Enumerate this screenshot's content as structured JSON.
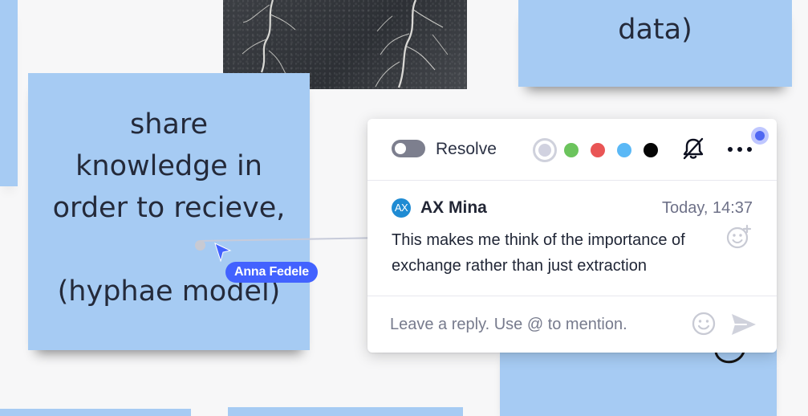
{
  "board": {
    "notes": [
      {
        "text": ""
      },
      {
        "text": "share\nknowledge in\norder to recieve,\n\n(hyphae model)"
      },
      {
        "text": "data)"
      },
      {
        "text": ""
      },
      {
        "text": ""
      },
      {
        "text": ""
      }
    ],
    "note_color": "#a6cbf3",
    "photo_icon": "hyphae-photo-icon"
  },
  "collaborator_cursor": {
    "name": "Anna Fedele",
    "color": "#4262ff"
  },
  "comment_panel": {
    "resolve_label": "Resolve",
    "toggle_state": "off",
    "color_options": [
      {
        "name": "grey",
        "hex": "#d1d2e0",
        "selected": true
      },
      {
        "name": "green",
        "hex": "#6cc45d",
        "selected": false
      },
      {
        "name": "red",
        "hex": "#e95555",
        "selected": false
      },
      {
        "name": "light-blue",
        "hex": "#5ab8f6",
        "selected": false
      },
      {
        "name": "black",
        "hex": "#050505",
        "selected": false
      }
    ],
    "icons": {
      "notifications": "bell-off-icon",
      "more": "more-horizontal-icon",
      "status": "status-dot-icon",
      "reaction": "add-reaction-icon",
      "reply_emoji": "emoji-icon",
      "send": "send-icon"
    },
    "comment": {
      "avatar_initials": "AX",
      "author": "AX Mina",
      "timestamp": "Today, 14:37",
      "text": "This makes me think of the importance of exchange rather than just extraction"
    },
    "reply": {
      "value": "",
      "placeholder": "Leave a reply. Use @ to mention."
    }
  }
}
